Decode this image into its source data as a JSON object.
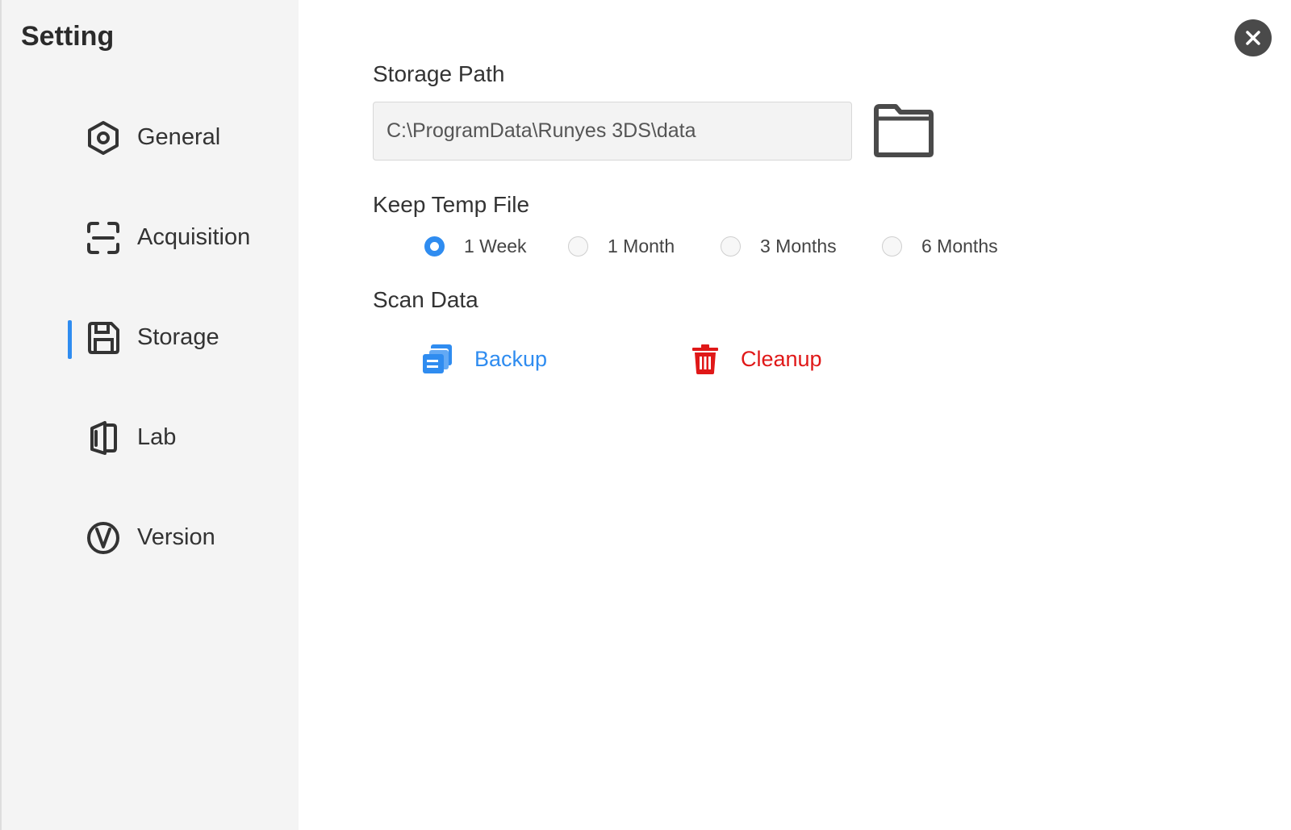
{
  "sidebar": {
    "title": "Setting",
    "active": "Storage",
    "items": [
      {
        "label": "General",
        "icon": "hexagon-gear-icon"
      },
      {
        "label": "Acquisition",
        "icon": "scan-frame-icon"
      },
      {
        "label": "Storage",
        "icon": "floppy-disk-icon"
      },
      {
        "label": "Lab",
        "icon": "lab-book-icon"
      },
      {
        "label": "Version",
        "icon": "version-v-icon"
      }
    ]
  },
  "main": {
    "storage_path": {
      "title": "Storage Path",
      "value": "C:\\ProgramData\\Runyes 3DS\\data",
      "browse_icon": "folder-icon"
    },
    "keep_temp_file": {
      "title": "Keep Temp File",
      "selected": "1 Week",
      "options": [
        "1 Week",
        "1 Month",
        "3 Months",
        "6 Months"
      ]
    },
    "scan_data": {
      "title": "Scan Data",
      "backup_label": "Backup",
      "cleanup_label": "Cleanup"
    }
  },
  "colors": {
    "accent": "#2f8cf0",
    "danger": "#e01818",
    "sidebar_bg": "#f4f4f4"
  }
}
